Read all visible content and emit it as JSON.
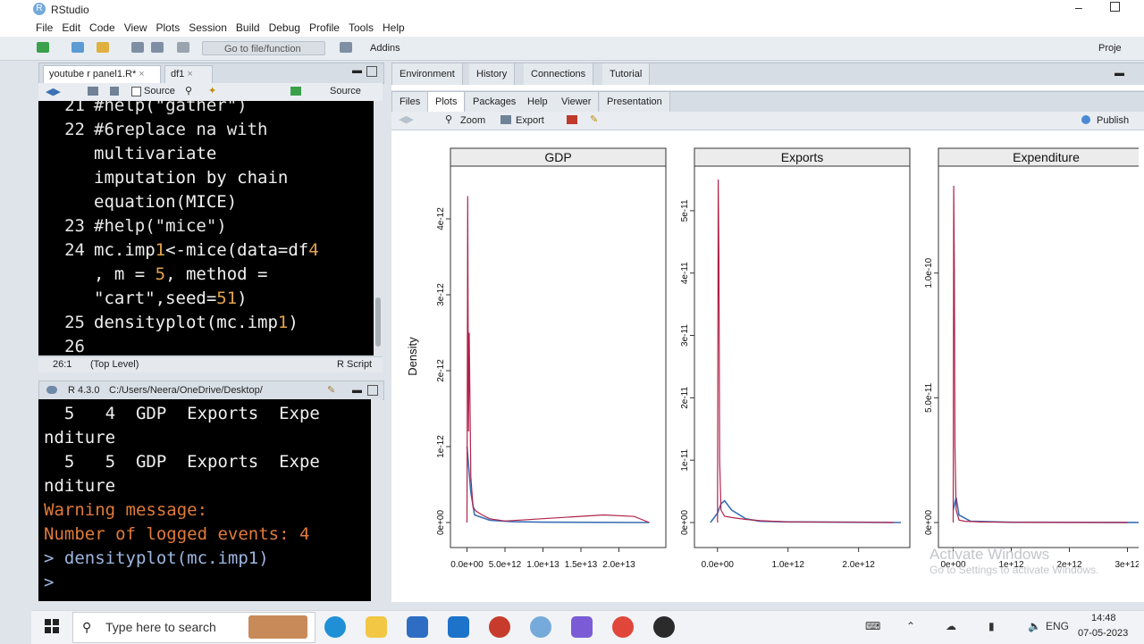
{
  "window": {
    "title": "RStudio"
  },
  "menu": [
    "File",
    "Edit",
    "Code",
    "View",
    "Plots",
    "Session",
    "Build",
    "Debug",
    "Profile",
    "Tools",
    "Help"
  ],
  "toolbar": {
    "goto_label": "Go to file/function",
    "addins_label": "Addins",
    "project_label": "Proje"
  },
  "editor": {
    "tabs": [
      "youtube r panel1.R*",
      "df1"
    ],
    "source_on_save": "Source",
    "source_button": "Source",
    "lines": [
      {
        "num": "21",
        "text": "#help(\"gather\")"
      },
      {
        "num": "22",
        "text": "#6replace na with"
      },
      {
        "num": "",
        "text": "multivariate"
      },
      {
        "num": "",
        "text": "imputation by chain"
      },
      {
        "num": "",
        "text": "equation(MICE)"
      },
      {
        "num": "23",
        "text": "#help(\"mice\")"
      },
      {
        "num": "24",
        "text": "mc.imp1<-mice(data=df4"
      },
      {
        "num": "",
        "text": ", m = 5, method ="
      },
      {
        "num": "",
        "text": "\"cart\",seed=51)"
      },
      {
        "num": "25",
        "text": "densityplot(mc.imp1)"
      },
      {
        "num": "26",
        "text": ""
      }
    ],
    "status": {
      "position": "26:1",
      "scope": "(Top Level)",
      "type": "R Script"
    }
  },
  "console": {
    "version": "R 4.3.0",
    "path": "C:/Users/Neera/OneDrive/Desktop/",
    "lines": [
      {
        "text": "  5   4  GDP  Exports  Expe",
        "kind": "out"
      },
      {
        "text": "nditure",
        "kind": "out"
      },
      {
        "text": "  5   5  GDP  Exports  Expe",
        "kind": "out"
      },
      {
        "text": "nditure",
        "kind": "out"
      },
      {
        "text": "Warning message:",
        "kind": "warn"
      },
      {
        "text": "Number of logged events: 4",
        "kind": "warn"
      },
      {
        "text": "> densityplot(mc.imp1)",
        "kind": "cmd"
      },
      {
        "text": "> ",
        "kind": "prompt"
      }
    ]
  },
  "env_tabs": [
    "Environment",
    "History",
    "Connections",
    "Tutorial"
  ],
  "files_tabs": [
    "Files",
    "Plots",
    "Packages",
    "Help",
    "Viewer",
    "Presentation"
  ],
  "plots_toolbar": {
    "zoom": "Zoom",
    "export": "Export",
    "publish": "Publish"
  },
  "chart_data": [
    {
      "type": "line",
      "title": "GDP",
      "ylabel": "Density",
      "ylim": [
        0,
        4.6e-12
      ],
      "yticks": [
        "0e+00",
        "1e-12",
        "2e-12",
        "3e-12",
        "4e-12"
      ],
      "xticks": [
        "0.0e+00",
        "5.0e+12",
        "1.0e+13",
        "1.5e+13",
        "2.0e+13"
      ],
      "xlim": [
        -1000000000000.0,
        25000000000000.0
      ],
      "series": [
        {
          "color": "#3b6fb6",
          "x": [
            0,
            500000000000.0,
            1000000000000.0,
            3000000000000.0,
            6000000000000.0,
            10000000000000.0,
            24000000000000.0
          ],
          "y": [
            1e-12,
            4e-13,
            1e-13,
            3e-14,
            1e-14,
            5e-15,
            0
          ]
        },
        {
          "color": "#b0234b",
          "x": [
            0,
            100000000000.0,
            200000000000.0,
            300000000000.0,
            500000000000.0,
            800000000000.0,
            1200000000000.0,
            2000000000000.0,
            3000000000000.0,
            5000000000000.0,
            18000000000000.0,
            22000000000000.0,
            24000000000000.0
          ],
          "y": [
            0,
            4.3e-12,
            1.2e-12,
            2.5e-12,
            6e-13,
            2e-13,
            1.5e-13,
            1e-13,
            5e-14,
            2e-14,
            1e-13,
            8e-14,
            0
          ]
        }
      ]
    },
    {
      "type": "line",
      "title": "Exports",
      "ylim": [
        0,
        5.6e-11
      ],
      "yticks": [
        "0e+00",
        "1e-11",
        "2e-11",
        "3e-11",
        "4e-11",
        "5e-11"
      ],
      "xticks": [
        "0.0e+00",
        "1.0e+12",
        "2.0e+12"
      ],
      "xlim": [
        -200000000000.0,
        2600000000000.0
      ],
      "series": [
        {
          "color": "#3b6fb6",
          "x": [
            -100000000000.0,
            0,
            50000000000.0,
            100000000000.0,
            200000000000.0,
            400000000000.0,
            600000000000.0,
            1000000000000.0,
            2000000000000.0,
            2600000000000.0
          ],
          "y": [
            0,
            1.5e-12,
            3e-12,
            3.5e-12,
            2e-12,
            6e-13,
            2e-13,
            1e-13,
            5e-14,
            0
          ]
        },
        {
          "color": "#b0234b",
          "x": [
            0,
            10000000000.0,
            20000000000.0,
            30000000000.0,
            50000000000.0,
            100000000000.0,
            200000000000.0,
            400000000000.0,
            600000000000.0,
            800000000000.0,
            1000000000000.0,
            2000000000000.0,
            2500000000000.0
          ],
          "y": [
            0,
            5.5e-11,
            4.2e-11,
            1e-11,
            2e-12,
            1e-12,
            8e-13,
            5e-13,
            3e-13,
            2e-13,
            1e-13,
            5e-14,
            0
          ]
        }
      ]
    },
    {
      "type": "line",
      "title": "Expenditure",
      "ylim": [
        0,
        1.4e-10
      ],
      "yticks": [
        "0e+00",
        "5.0e-11",
        "1.0e-10"
      ],
      "xticks": [
        "0e+00",
        "1e+12",
        "2e+12",
        "3e+12"
      ],
      "xlim": [
        -100000000000.0,
        3300000000000.0
      ],
      "series": [
        {
          "color": "#3b6fb6",
          "x": [
            0,
            50000000000.0,
            100000000000.0,
            300000000000.0,
            1000000000000.0,
            3300000000000.0
          ],
          "y": [
            5e-12,
            1e-11,
            3e-12,
            5e-13,
            1e-13,
            0
          ]
        },
        {
          "color": "#b0234b",
          "x": [
            0,
            10000000000.0,
            20000000000.0,
            30000000000.0,
            50000000000.0,
            100000000000.0,
            200000000000.0,
            500000000000.0,
            1000000000000.0,
            3000000000000.0
          ],
          "y": [
            0,
            1.35e-10,
            1.02e-10,
            3e-11,
            5e-12,
            1e-12,
            5e-13,
            2e-13,
            1e-13,
            0
          ]
        }
      ]
    }
  ],
  "watermark": {
    "line1": "Activate Windows",
    "line2": "Go to Settings to activate Windows."
  },
  "taskbar": {
    "search_placeholder": "Type here to search",
    "lang": "ENG",
    "time": "14:48",
    "date": "07-05-2023"
  }
}
